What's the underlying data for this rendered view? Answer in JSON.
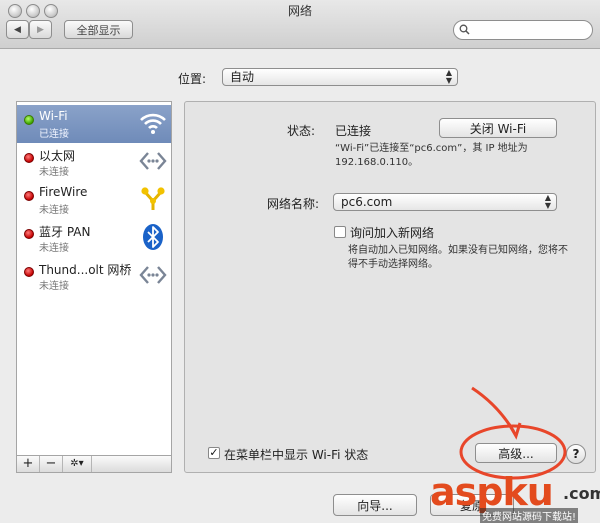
{
  "window": {
    "title": "网络"
  },
  "toolbar": {
    "back_icon": "◀",
    "forward_icon": "▶",
    "show_all_label": "全部显示",
    "search_placeholder": ""
  },
  "location": {
    "label": "位置:",
    "value": "自动"
  },
  "services": [
    {
      "name": "Wi-Fi",
      "status": "已连接",
      "state": "connected",
      "icon": "wifi-icon"
    },
    {
      "name": "以太网",
      "status": "未连接",
      "state": "disconnected",
      "icon": "ethernet-icon"
    },
    {
      "name": "FireWire",
      "status": "未连接",
      "state": "disconnected",
      "icon": "firewire-icon"
    },
    {
      "name": "蓝牙 PAN",
      "status": "未连接",
      "state": "disconnected",
      "icon": "bluetooth-icon"
    },
    {
      "name": "Thund...olt 网桥",
      "status": "未连接",
      "state": "disconnected",
      "icon": "thunderbolt-bridge-icon"
    }
  ],
  "sidebar_buttons": {
    "add": "+",
    "remove": "−",
    "gear": "✲▾"
  },
  "detail": {
    "status_label": "状态:",
    "status_value": "已连接",
    "turn_off_button": "关闭 Wi-Fi",
    "status_desc_line1": "“Wi-Fi”已连接至“pc6.com”，其 IP 地址为",
    "status_desc_line2": "192.168.0.110。",
    "network_name_label": "网络名称:",
    "network_name_value": "pc6.com",
    "ask_join_label": "询问加入新网络",
    "ask_join_checked": false,
    "ask_join_desc_line1": "将自动加入已知网络。如果没有已知网络，您将不",
    "ask_join_desc_line2": "得不手动选择网络。",
    "show_in_menubar_label": "在菜单栏中显示 Wi-Fi 状态",
    "show_in_menubar_checked": true,
    "advanced_button": "高级...",
    "help_button": "?"
  },
  "bottom": {
    "assist_button": "向导...",
    "revert_button": "复原"
  },
  "watermark": {
    "text": "aspku",
    "dotcom": ".com",
    "sub": "免费网站源码下载站!"
  },
  "colors": {
    "accent_selected": "#7b95c2",
    "annotation": "#e8462a"
  }
}
